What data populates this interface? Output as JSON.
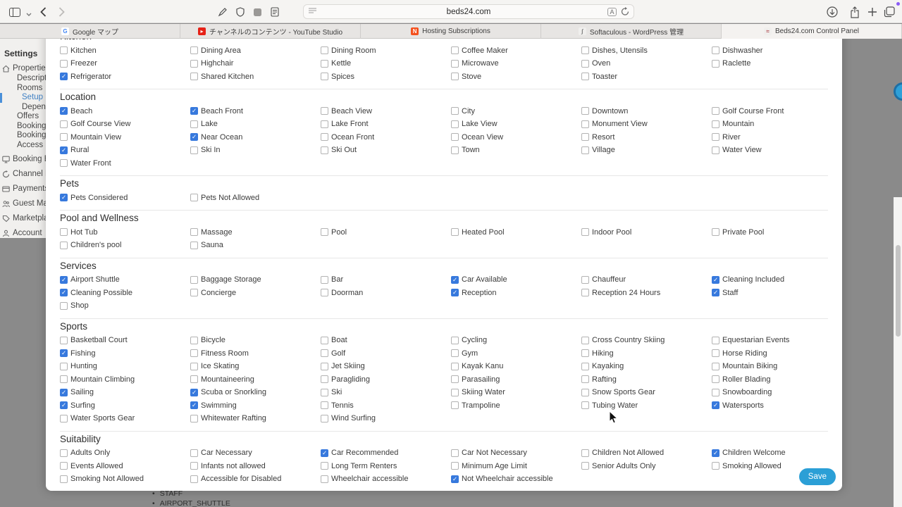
{
  "colors": {
    "check_blue": "#3779dd",
    "save_blue": "#2b9fd6",
    "dim_background": "#8a8a8a",
    "active_menu_blue": "#3f80c4"
  },
  "browser": {
    "url": "beds24.com",
    "toolbar_icons": [
      "sidebar-toggle-icon",
      "sidebar-chevron-icon",
      "back-icon",
      "forward-icon",
      "markup-icon",
      "privacy-shield-icon",
      "extensions-icon",
      "page-icon",
      "download-icon",
      "share-icon",
      "new-tab-icon",
      "tab-overview-icon",
      "translate-icon",
      "reload-icon",
      "reader-icon"
    ],
    "tabs": [
      {
        "label": "Google マップ",
        "favicon": "google",
        "active": false
      },
      {
        "label": "チャンネルのコンテンツ - YouTube Studio",
        "favicon": "youtube",
        "active": false
      },
      {
        "label": "Hosting Subscriptions",
        "favicon": "hosting",
        "active": false
      },
      {
        "label": "Softaculous - WordPress 管理",
        "favicon": "softaculous",
        "active": false
      },
      {
        "label": "Beds24.com Control Panel",
        "favicon": "beds24",
        "active": true
      }
    ]
  },
  "menu": {
    "items": [
      {
        "label": "Settings",
        "level": 0
      },
      {
        "label": "Properties",
        "level": 1,
        "icon": "home-icon"
      },
      {
        "label": "Descriptio",
        "level": 2
      },
      {
        "label": "Rooms",
        "level": 2
      },
      {
        "label": "Setup",
        "level": 3,
        "active": true
      },
      {
        "label": "Depende",
        "level": 3
      },
      {
        "label": "Offers",
        "level": 2
      },
      {
        "label": "Booking P",
        "level": 2
      },
      {
        "label": "Booking C",
        "level": 2
      },
      {
        "label": "Access",
        "level": 2
      },
      {
        "label": "Booking En",
        "level": 1,
        "icon": "monitor-icon"
      },
      {
        "label": "Channel Ma",
        "level": 1,
        "icon": "sync-icon"
      },
      {
        "label": "Payments",
        "level": 1,
        "icon": "card-icon"
      },
      {
        "label": "Guest Mana",
        "level": 1,
        "icon": "people-icon"
      },
      {
        "label": "Marketplac",
        "level": 1,
        "icon": "tag-icon"
      },
      {
        "label": "Account",
        "level": 1,
        "icon": "person-icon"
      }
    ]
  },
  "sections": [
    {
      "title": "Kitchen",
      "items": [
        {
          "label": "Kitchen",
          "checked": false
        },
        {
          "label": "Dining Area",
          "checked": false
        },
        {
          "label": "Dining Room",
          "checked": false
        },
        {
          "label": "Coffee Maker",
          "checked": false
        },
        {
          "label": "Dishes, Utensils",
          "checked": false
        },
        {
          "label": "Dishwasher",
          "checked": false
        },
        {
          "label": "Freezer",
          "checked": false
        },
        {
          "label": "Highchair",
          "checked": false
        },
        {
          "label": "Kettle",
          "checked": false
        },
        {
          "label": "Microwave",
          "checked": false
        },
        {
          "label": "Oven",
          "checked": false
        },
        {
          "label": "Raclette",
          "checked": false
        },
        {
          "label": "Refrigerator",
          "checked": true
        },
        {
          "label": "Shared Kitchen",
          "checked": false
        },
        {
          "label": "Spices",
          "checked": false
        },
        {
          "label": "Stove",
          "checked": false
        },
        {
          "label": "Toaster",
          "checked": false
        }
      ]
    },
    {
      "title": "Location",
      "items": [
        {
          "label": "Beach",
          "checked": true
        },
        {
          "label": "Beach Front",
          "checked": true
        },
        {
          "label": "Beach View",
          "checked": false
        },
        {
          "label": "City",
          "checked": false
        },
        {
          "label": "Downtown",
          "checked": false
        },
        {
          "label": "Golf Course Front",
          "checked": false
        },
        {
          "label": "Golf Course View",
          "checked": false
        },
        {
          "label": "Lake",
          "checked": false
        },
        {
          "label": "Lake Front",
          "checked": false
        },
        {
          "label": "Lake View",
          "checked": false
        },
        {
          "label": "Monument View",
          "checked": false
        },
        {
          "label": "Mountain",
          "checked": false
        },
        {
          "label": "Mountain View",
          "checked": false
        },
        {
          "label": "Near Ocean",
          "checked": true
        },
        {
          "label": "Ocean Front",
          "checked": false
        },
        {
          "label": "Ocean View",
          "checked": false
        },
        {
          "label": "Resort",
          "checked": false
        },
        {
          "label": "River",
          "checked": false
        },
        {
          "label": "Rural",
          "checked": true
        },
        {
          "label": "Ski In",
          "checked": false
        },
        {
          "label": "Ski Out",
          "checked": false
        },
        {
          "label": "Town",
          "checked": false
        },
        {
          "label": "Village",
          "checked": false
        },
        {
          "label": "Water View",
          "checked": false
        },
        {
          "label": "Water Front",
          "checked": false
        }
      ]
    },
    {
      "title": "Pets",
      "items": [
        {
          "label": "Pets Considered",
          "checked": true
        },
        {
          "label": "Pets Not Allowed",
          "checked": false
        }
      ]
    },
    {
      "title": "Pool and Wellness",
      "items": [
        {
          "label": "Hot Tub",
          "checked": false
        },
        {
          "label": "Massage",
          "checked": false
        },
        {
          "label": "Pool",
          "checked": false
        },
        {
          "label": "Heated Pool",
          "checked": false
        },
        {
          "label": "Indoor Pool",
          "checked": false
        },
        {
          "label": "Private Pool",
          "checked": false
        },
        {
          "label": "Children's pool",
          "checked": false
        },
        {
          "label": "Sauna",
          "checked": false
        }
      ]
    },
    {
      "title": "Services",
      "items": [
        {
          "label": "Airport Shuttle",
          "checked": true
        },
        {
          "label": "Baggage Storage",
          "checked": false
        },
        {
          "label": "Bar",
          "checked": false
        },
        {
          "label": "Car Available",
          "checked": true
        },
        {
          "label": "Chauffeur",
          "checked": false
        },
        {
          "label": "Cleaning Included",
          "checked": true
        },
        {
          "label": "Cleaning Possible",
          "checked": true
        },
        {
          "label": "Concierge",
          "checked": false
        },
        {
          "label": "Doorman",
          "checked": false
        },
        {
          "label": "Reception",
          "checked": true
        },
        {
          "label": "Reception 24 Hours",
          "checked": false
        },
        {
          "label": "Staff",
          "checked": true
        },
        {
          "label": "Shop",
          "checked": false
        }
      ]
    },
    {
      "title": "Sports",
      "items": [
        {
          "label": "Basketball Court",
          "checked": false
        },
        {
          "label": "Bicycle",
          "checked": false
        },
        {
          "label": "Boat",
          "checked": false
        },
        {
          "label": "Cycling",
          "checked": false
        },
        {
          "label": "Cross Country Skiing",
          "checked": false
        },
        {
          "label": "Equestarian Events",
          "checked": false
        },
        {
          "label": "Fishing",
          "checked": true
        },
        {
          "label": "Fitness Room",
          "checked": false
        },
        {
          "label": "Golf",
          "checked": false
        },
        {
          "label": "Gym",
          "checked": false
        },
        {
          "label": "Hiking",
          "checked": false
        },
        {
          "label": "Horse Riding",
          "checked": false
        },
        {
          "label": "Hunting",
          "checked": false
        },
        {
          "label": "Ice Skating",
          "checked": false
        },
        {
          "label": "Jet Skiing",
          "checked": false
        },
        {
          "label": "Kayak Kanu",
          "checked": false
        },
        {
          "label": "Kayaking",
          "checked": false
        },
        {
          "label": "Mountain Biking",
          "checked": false
        },
        {
          "label": "Mountain Climbing",
          "checked": false
        },
        {
          "label": "Mountaineering",
          "checked": false
        },
        {
          "label": "Paragliding",
          "checked": false
        },
        {
          "label": "Parasailing",
          "checked": false
        },
        {
          "label": "Rafting",
          "checked": false
        },
        {
          "label": "Roller Blading",
          "checked": false
        },
        {
          "label": "Sailing",
          "checked": true
        },
        {
          "label": "Scuba or Snorkling",
          "checked": true
        },
        {
          "label": "Ski",
          "checked": false
        },
        {
          "label": "Skiing Water",
          "checked": false
        },
        {
          "label": "Snow Sports Gear",
          "checked": false
        },
        {
          "label": "Snowboarding",
          "checked": false
        },
        {
          "label": "Surfing",
          "checked": true
        },
        {
          "label": "Swimming",
          "checked": true
        },
        {
          "label": "Tennis",
          "checked": false
        },
        {
          "label": "Trampoline",
          "checked": false
        },
        {
          "label": "Tubing Water",
          "checked": false
        },
        {
          "label": "Watersports",
          "checked": true
        },
        {
          "label": "Water Sports Gear",
          "checked": false
        },
        {
          "label": "Whitewater Rafting",
          "checked": false
        },
        {
          "label": "Wind Surfing",
          "checked": false
        }
      ]
    },
    {
      "title": "Suitability",
      "items": [
        {
          "label": "Adults Only",
          "checked": false
        },
        {
          "label": "Car Necessary",
          "checked": false
        },
        {
          "label": "Car Recommended",
          "checked": true
        },
        {
          "label": "Car Not Necessary",
          "checked": false
        },
        {
          "label": "Children Not Allowed",
          "checked": false
        },
        {
          "label": "Children Welcome",
          "checked": true
        },
        {
          "label": "Events Allowed",
          "checked": false
        },
        {
          "label": "Infants not allowed",
          "checked": false
        },
        {
          "label": "Long Term Renters",
          "checked": false
        },
        {
          "label": "Minimum Age Limit",
          "checked": false
        },
        {
          "label": "Senior Adults Only",
          "checked": false
        },
        {
          "label": "Smoking Allowed",
          "checked": false
        },
        {
          "label": "Smoking Not Allowed",
          "checked": false
        },
        {
          "label": "Accessible for Disabled",
          "checked": false
        },
        {
          "label": "Wheelchair accessible",
          "checked": false
        },
        {
          "label": "Not Wheelchair accessible",
          "checked": true
        }
      ]
    }
  ],
  "save_label": "Save",
  "background_list": [
    "STAFF",
    "AIRPORT_SHUTTLE"
  ]
}
